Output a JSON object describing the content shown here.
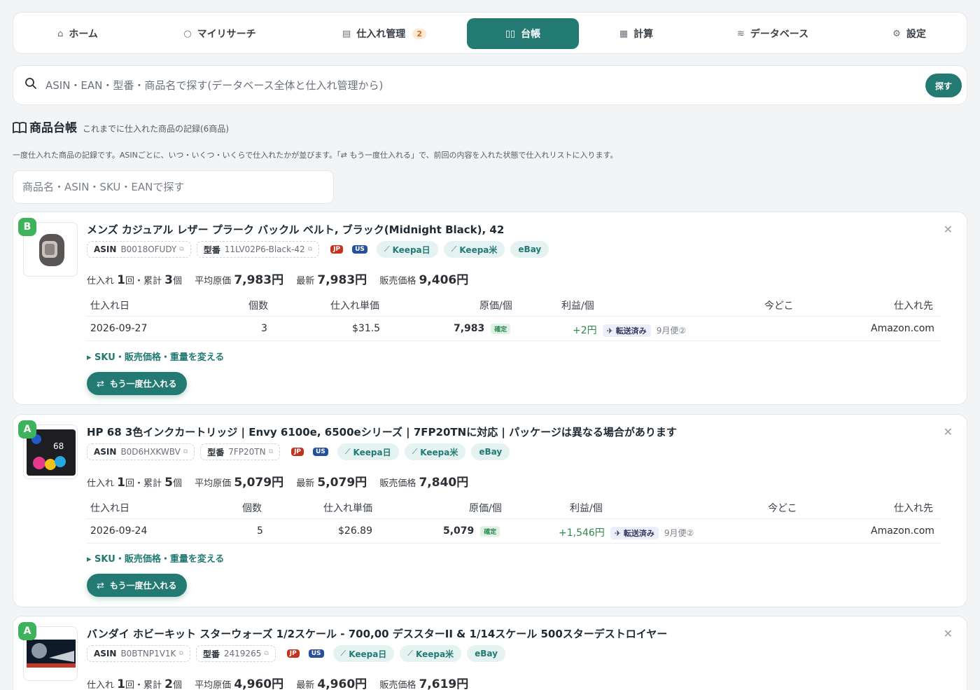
{
  "nav": [
    {
      "label": "ホーム",
      "icon": "home-icon",
      "glyph": "⌂"
    },
    {
      "label": "マイリサーチ",
      "icon": "search-icon",
      "glyph": "○"
    },
    {
      "label": "仕入れ管理",
      "icon": "clipboard-icon",
      "glyph": "▤",
      "badge": "2"
    },
    {
      "label": "台帳",
      "icon": "book-icon",
      "glyph": "▯▯",
      "active": true
    },
    {
      "label": "計算",
      "icon": "calculator-icon",
      "glyph": "▦"
    },
    {
      "label": "データベース",
      "icon": "database-icon",
      "glyph": "≋"
    },
    {
      "label": "設定",
      "icon": "gear-icon",
      "glyph": "⚙"
    }
  ],
  "search": {
    "placeholder": "ASIN・EAN・型番・商品名で探す(データベース全体と仕入れ管理から)",
    "button": "探す"
  },
  "section": {
    "title": "商品台帳",
    "subtitle": "これまでに仕入れた商品の記録(6商品)",
    "description": "一度仕入れた商品の記録です。ASINごとに、いつ・いくつ・いくらで仕入れたかが並びます。「⇄ もう一度仕入れる」で、前回の内容を入れた状態で仕入れリストに入ります。"
  },
  "filter": {
    "placeholder": "商品名・ASIN・SKU・EANで探す"
  },
  "labels": {
    "asin": "ASIN",
    "model": "型番",
    "jp": "JP",
    "us": "US",
    "keepa_jp": "Keepa日",
    "keepa_us": "Keepa米",
    "ebay": "eBay",
    "purchase": "仕入れ",
    "times_unit": "回・累計",
    "pieces_unit": "個",
    "avg_cost": "平均原価",
    "latest": "最新",
    "sale_price": "販売価格",
    "confirmed": "確定",
    "shipped": "転送済み",
    "sku_toggle": "▸ SKU・販売価格・重量を変える",
    "reorder": "もう一度仕入れる",
    "columns": [
      "仕入れ日",
      "個数",
      "仕入れ単価",
      "原価/個",
      "利益/個",
      "今どこ",
      "仕入れ先"
    ]
  },
  "products": [
    {
      "grade": "B",
      "title": "メンズ カジュアル レザー プラーク バックル ベルト, ブラック(Midnight Black), 42",
      "asin": "B0018OFUDY",
      "model": "11LV02P6-Black-42",
      "times": "1",
      "total": "3",
      "avg_cost": "7,983円",
      "latest": "7,983円",
      "sale_price": "9,406円",
      "rows": [
        {
          "date": "2026-09-27",
          "qty": "3",
          "unit_price": "$31.5",
          "cost": "7,983",
          "profit": "+2円",
          "ship_month": "9月便②",
          "supplier": "Amazon.com"
        }
      ]
    },
    {
      "grade": "A",
      "title": "HP 68 3色インクカートリッジ | Envy 6100e, 6500eシリーズ | 7FP20TNに対応 | パッケージは異なる場合があります",
      "asin": "B0D6HXKWBV",
      "model": "7FP20TN",
      "times": "1",
      "total": "5",
      "avg_cost": "5,079円",
      "latest": "5,079円",
      "sale_price": "7,840円",
      "rows": [
        {
          "date": "2026-09-24",
          "qty": "5",
          "unit_price": "$26.89",
          "cost": "5,079",
          "profit": "+1,546円",
          "ship_month": "9月便②",
          "supplier": "Amazon.com"
        }
      ]
    },
    {
      "grade": "A",
      "title": "バンダイ ホビーキット スターウォーズ 1/2スケール - 700,00 デススターII & 1/14スケール 500スターデストロイヤー",
      "asin": "B0BTNP1V1K",
      "model": "2419265",
      "times": "1",
      "total": "2",
      "avg_cost": "4,960円",
      "latest": "4,960円",
      "sale_price": "7,619円"
    }
  ],
  "colors": {
    "accent": "#237a73",
    "grade": "#3eb35b",
    "badge": "#d06a1c"
  }
}
